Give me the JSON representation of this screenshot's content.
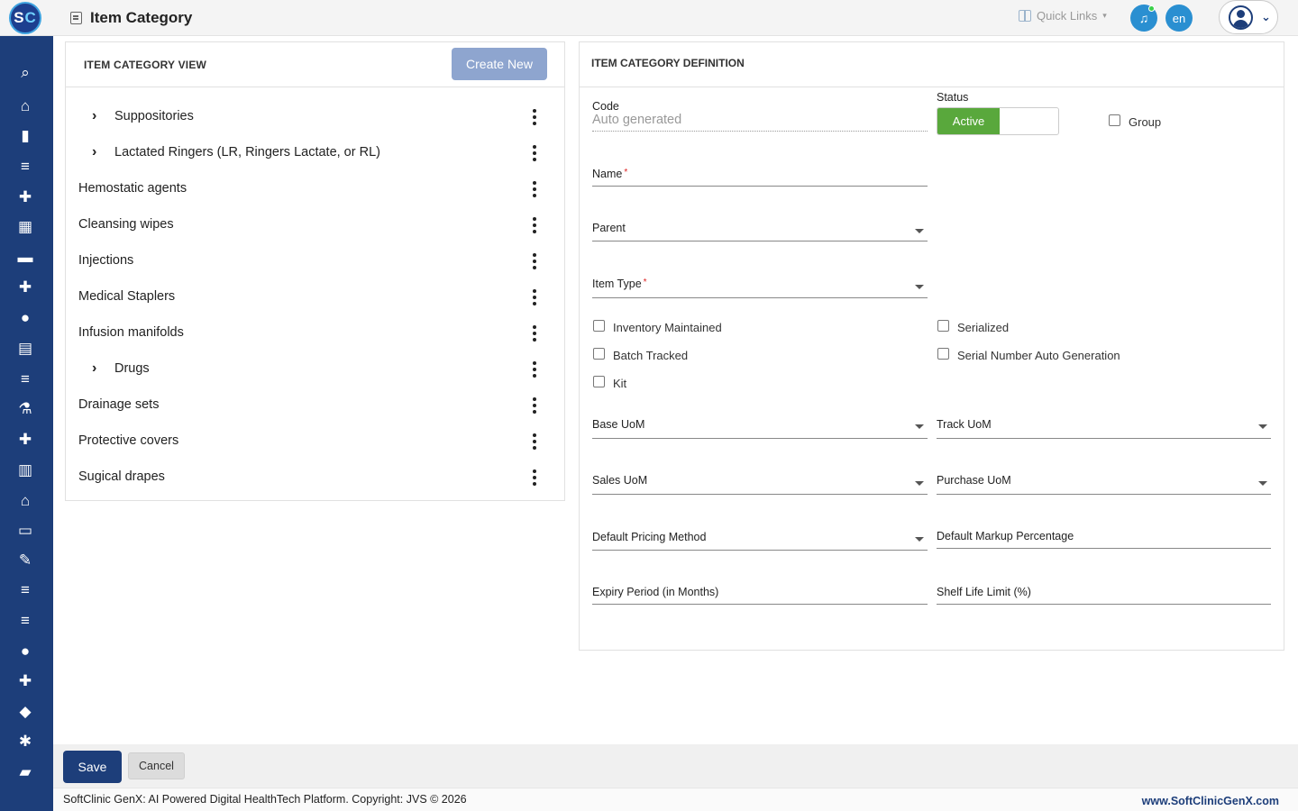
{
  "header": {
    "logo_text_s": "S",
    "logo_text_c": "C",
    "page_title": "Item Category",
    "quick_links_label": "Quick Links",
    "language": "en"
  },
  "sidebar": {
    "items": [
      {
        "name": "search",
        "glyph": "⌕"
      },
      {
        "name": "home",
        "glyph": "⌂"
      },
      {
        "name": "analytics",
        "glyph": "▮"
      },
      {
        "name": "menu-1",
        "glyph": "≡"
      },
      {
        "name": "doctor-bag",
        "glyph": "✚"
      },
      {
        "name": "calendar",
        "glyph": "▦"
      },
      {
        "name": "bed",
        "glyph": "▬"
      },
      {
        "name": "medical-plus",
        "glyph": "✚"
      },
      {
        "name": "person",
        "glyph": "●"
      },
      {
        "name": "receipt",
        "glyph": "▤"
      },
      {
        "name": "menu-2",
        "glyph": "≡"
      },
      {
        "name": "lab",
        "glyph": "⚗"
      },
      {
        "name": "pharmacy",
        "glyph": "✚"
      },
      {
        "name": "book",
        "glyph": "▥"
      },
      {
        "name": "store",
        "glyph": "⌂"
      },
      {
        "name": "devices",
        "glyph": "▭"
      },
      {
        "name": "wrench",
        "glyph": "✎"
      },
      {
        "name": "menu-3",
        "glyph": "≡"
      },
      {
        "name": "menu-4",
        "glyph": "≡"
      },
      {
        "name": "blood-drop",
        "glyph": "●"
      },
      {
        "name": "add-box",
        "glyph": "✚"
      },
      {
        "name": "shield",
        "glyph": "◆"
      },
      {
        "name": "network",
        "glyph": "✱"
      },
      {
        "name": "folder",
        "glyph": "▰"
      }
    ]
  },
  "left_panel": {
    "title": "ITEM CATEGORY VIEW",
    "create_button": "Create New",
    "tree": [
      {
        "label": "Suppositories",
        "expandable": true
      },
      {
        "label": "Lactated Ringers (LR, Ringers Lactate, or RL)",
        "expandable": true
      },
      {
        "label": "Hemostatic agents",
        "expandable": false
      },
      {
        "label": "Cleansing wipes",
        "expandable": false
      },
      {
        "label": "Injections",
        "expandable": false
      },
      {
        "label": "Medical Staplers",
        "expandable": false
      },
      {
        "label": "Infusion manifolds",
        "expandable": false
      },
      {
        "label": "Drugs",
        "expandable": true
      },
      {
        "label": "Drainage sets",
        "expandable": false
      },
      {
        "label": "Protective covers",
        "expandable": false
      },
      {
        "label": "Sugical drapes",
        "expandable": false
      }
    ]
  },
  "right_panel": {
    "title": "ITEM CATEGORY DEFINITION",
    "code_label": "Code",
    "code_placeholder": "Auto generated",
    "status_label": "Status",
    "status_value": "Active",
    "group_label": "Group",
    "name_label": "Name",
    "required_mark": "*",
    "parent_label": "Parent",
    "item_type_label": "Item Type",
    "checkboxes": {
      "inventory_maintained": "Inventory Maintained",
      "serialized": "Serialized",
      "batch_tracked": "Batch Tracked",
      "serial_number_auto_generation": "Serial Number Auto Generation",
      "kit": "Kit"
    },
    "base_uom_label": "Base UoM",
    "track_uom_label": "Track UoM",
    "sales_uom_label": "Sales UoM",
    "purchase_uom_label": "Purchase UoM",
    "default_pricing_method_label": "Default Pricing Method",
    "default_markup_percentage_label": "Default Markup Percentage",
    "expiry_period_label": "Expiry Period (in Months)",
    "shelf_life_limit_label": "Shelf Life Limit (%)"
  },
  "actions": {
    "save": "Save",
    "cancel": "Cancel"
  },
  "footer": {
    "copyright": "SoftClinic GenX: AI Powered Digital HealthTech Platform. Copyright: JVS © 2026",
    "website": "www.SoftClinicGenX.com"
  },
  "colors": {
    "sidebar_bg": "#1d3e7a",
    "primary": "#1d3e7a",
    "create_button_bg": "#8ea5cf",
    "status_active": "#59a83c",
    "notification": "#2a8fd1"
  }
}
